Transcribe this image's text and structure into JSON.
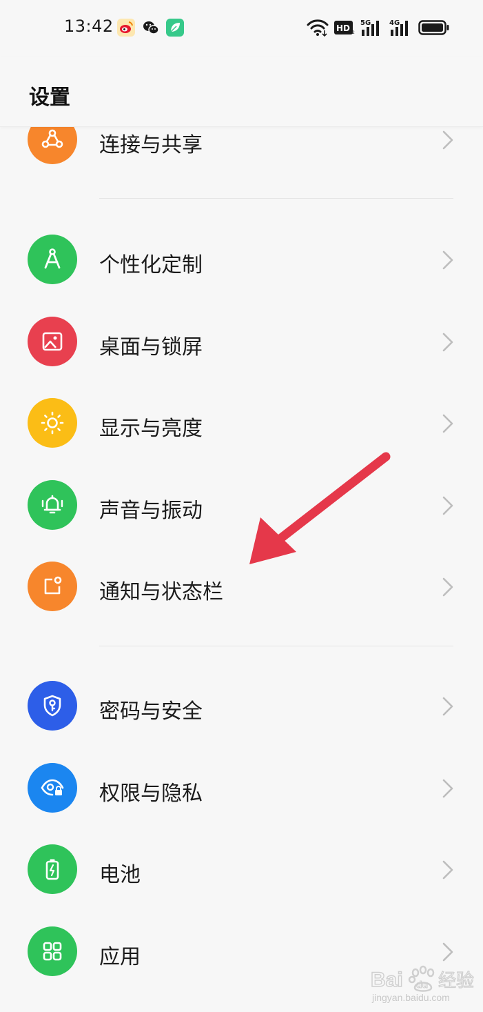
{
  "status_bar": {
    "time": "13:42",
    "app_icons": [
      "weibo-icon",
      "wechat-icon",
      "leaf-app-icon"
    ],
    "system_icons": [
      "wifi-icon",
      "hd-icon",
      "signal-5g-icon",
      "signal-4g-icon",
      "battery-icon"
    ],
    "hd_label": "HD",
    "net1_label": "5G",
    "net2_label": "4G"
  },
  "header": {
    "title": "设置"
  },
  "settings": {
    "items": [
      {
        "label": "连接与共享",
        "icon": "share-icon",
        "color": "#f7862c"
      },
      {
        "label": "个性化定制",
        "icon": "compass-icon",
        "color": "#2fc35a"
      },
      {
        "label": "桌面与锁屏",
        "icon": "image-icon",
        "color": "#e8404f"
      },
      {
        "label": "显示与亮度",
        "icon": "sun-icon",
        "color": "#fbbd16"
      },
      {
        "label": "声音与振动",
        "icon": "bell-icon",
        "color": "#2fc35a"
      },
      {
        "label": "通知与状态栏",
        "icon": "notification-icon",
        "color": "#f7862c"
      },
      {
        "label": "密码与安全",
        "icon": "shield-key-icon",
        "color": "#2d5ee8"
      },
      {
        "label": "权限与隐私",
        "icon": "eye-lock-icon",
        "color": "#1b86f0"
      },
      {
        "label": "电池",
        "icon": "battery-charge-icon",
        "color": "#2fc35a"
      },
      {
        "label": "应用",
        "icon": "grid-icon",
        "color": "#2fc35a"
      }
    ]
  },
  "annotation": {
    "type": "arrow",
    "color": "#e5384a"
  },
  "watermark": {
    "brand": "Baidu经验",
    "url": "jingyan.baidu.com"
  }
}
